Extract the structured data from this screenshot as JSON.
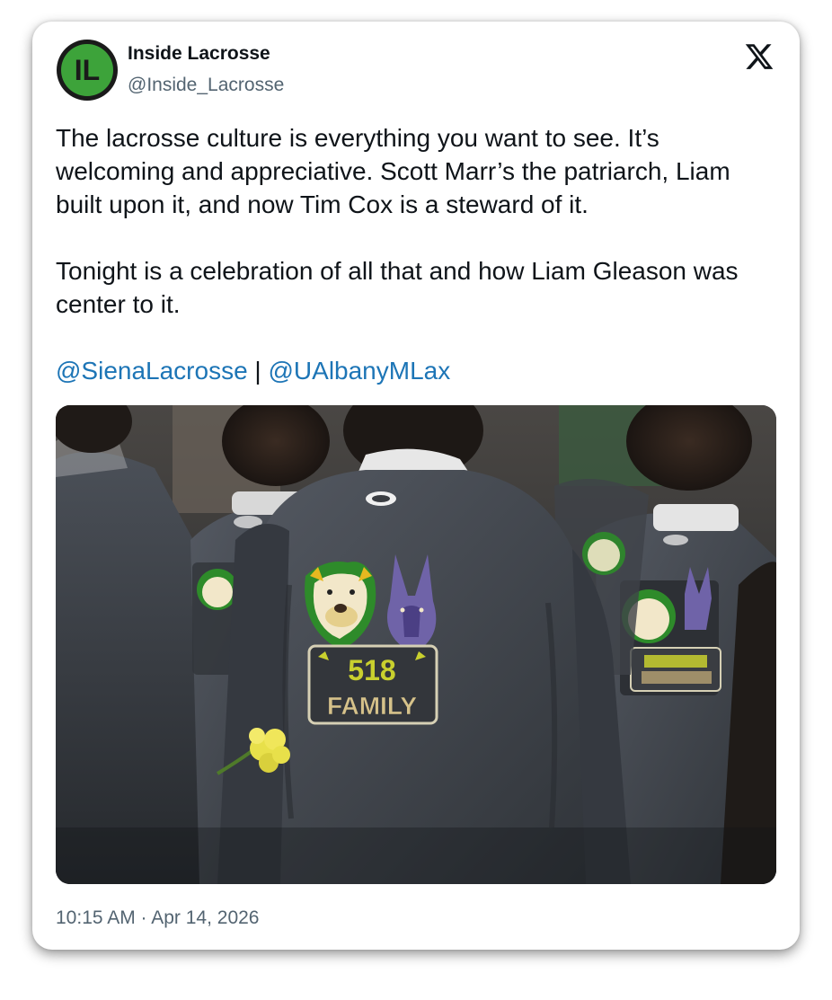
{
  "author": {
    "avatar_text": "IL",
    "name": "Inside Lacrosse",
    "handle": "@Inside_Lacrosse"
  },
  "platform_icon": "x-logo-icon",
  "tweet": {
    "paragraph_1": "The lacrosse culture is everything you want to see. It’s welcoming and appreciative. Scott Marr’s the patriarch, Liam built upon it, and now Tim Cox is a steward of it.",
    "paragraph_2": "Tonight is a celebration of all that and how Liam Gleason was center to it.",
    "mention_1": "@SienaLacrosse",
    "separator": " | ",
    "mention_2": "@UAlbanyMLax"
  },
  "photo": {
    "shirt_line_1": "518",
    "shirt_line_2": "FAMILY"
  },
  "timestamp": "10:15 AM · Apr 14, 2026",
  "colors": {
    "avatar_green": "#3da33a",
    "avatar_ring": "#1a1a1a",
    "mention": "#1d75b6",
    "text": "#0f1419",
    "muted": "#536471"
  }
}
